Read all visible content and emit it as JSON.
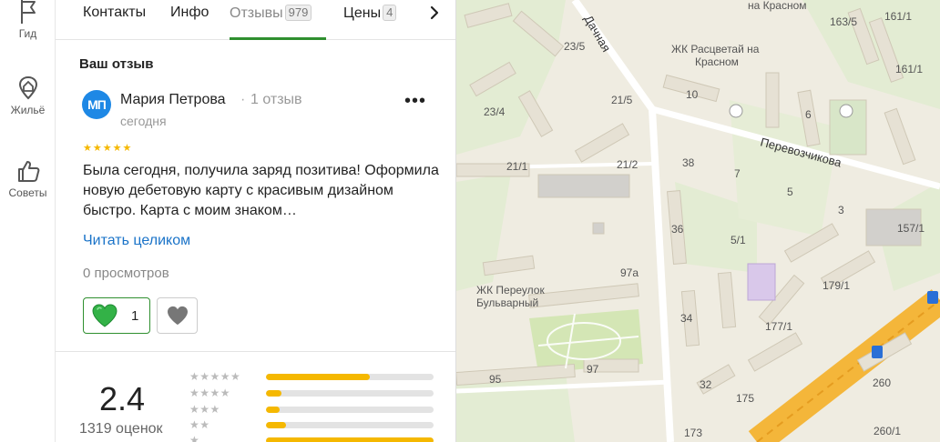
{
  "sidebar": {
    "items": [
      {
        "label": "Гид",
        "icon": "flag-icon"
      },
      {
        "label": "Жильё",
        "icon": "house-pin-icon"
      },
      {
        "label": "Советы",
        "icon": "thumbs-up-icon"
      }
    ]
  },
  "tabs": {
    "items": [
      {
        "label": "Контакты",
        "count": ""
      },
      {
        "label": "Инфо",
        "count": ""
      },
      {
        "label": "Отзывы",
        "count": "979"
      },
      {
        "label": "Цены",
        "count": "4"
      }
    ],
    "active": "Отзывы"
  },
  "review": {
    "section_title": "Ваш отзыв",
    "avatar_initials": "МП",
    "avatar_color": "#1e88e5",
    "author": "Мария Петрова",
    "separator": "·",
    "author_reviews": "1 отзыв",
    "date": "сегодня",
    "stars": "★★★★★",
    "stars_count": 5,
    "text": "Была сегодня, получила заряд позитива! Оформила новую дебетовую карту с красивым дизайном быстро. Карта с моим знаком…",
    "read_more": "Читать целиком",
    "views": "0 просмотров",
    "likes": "1"
  },
  "rating": {
    "value": "2.4",
    "count": "1319 оценок",
    "distribution": [
      {
        "stars": "★★★★★",
        "fraction": 0.62
      },
      {
        "stars": "★★★★",
        "fraction": 0.09
      },
      {
        "stars": "★★★",
        "fraction": 0.08
      },
      {
        "stars": "★★",
        "fraction": 0.12
      },
      {
        "stars": "★",
        "fraction": 1.0
      }
    ]
  },
  "map": {
    "streets": [
      "Дачная",
      "Перевозчикова"
    ],
    "places": [
      "на Красном",
      "ЖК Расцветай на",
      "Красном",
      "ЖК Переулок",
      "Бульварный"
    ],
    "houses": [
      "163/5",
      "161/1",
      "23/5",
      "10",
      "161/1",
      "21/5",
      "6",
      "23/4",
      "21/1",
      "21/2",
      "38",
      "7",
      "5",
      "3",
      "157/1",
      "36",
      "5/1",
      "97а",
      "179/1",
      "34",
      "177/1",
      "95",
      "97",
      "32",
      "175",
      "260",
      "173",
      "260/1"
    ]
  },
  "colors": {
    "accent_green": "#2f8f2f",
    "link_blue": "#1a73c8",
    "star_yellow": "#f5b800",
    "road_orange": "#f4b63a"
  }
}
